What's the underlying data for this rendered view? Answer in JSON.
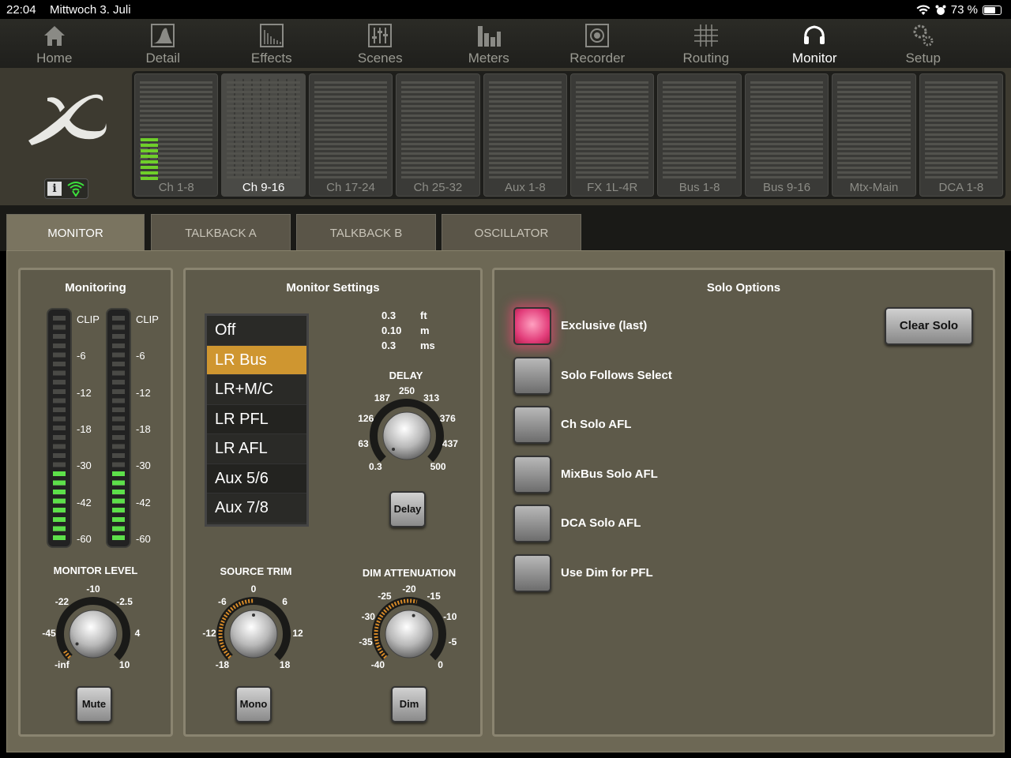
{
  "status": {
    "time": "22:04",
    "date": "Mittwoch 3. Juli",
    "battery": "73 %",
    "battery_level": 0.73
  },
  "nav": [
    {
      "label": "Home",
      "icon": "home-icon"
    },
    {
      "label": "Detail",
      "icon": "detail-icon"
    },
    {
      "label": "Effects",
      "icon": "effects-icon"
    },
    {
      "label": "Scenes",
      "icon": "scenes-icon"
    },
    {
      "label": "Meters",
      "icon": "meters-icon"
    },
    {
      "label": "Recorder",
      "icon": "recorder-icon"
    },
    {
      "label": "Routing",
      "icon": "routing-icon"
    },
    {
      "label": "Monitor",
      "icon": "monitor-icon",
      "active": true
    },
    {
      "label": "Setup",
      "icon": "setup-icon"
    }
  ],
  "banks": [
    "Ch 1-8",
    "Ch 9-16",
    "Ch 17-24",
    "Ch 25-32",
    "Aux 1-8",
    "FX 1L-4R",
    "Bus 1-8",
    "Bus 9-16",
    "Mtx-Main",
    "DCA 1-8"
  ],
  "selected_bank": "Ch 9-16",
  "tabs": [
    "MONITOR",
    "TALKBACK A",
    "TALKBACK B",
    "OSCILLATOR"
  ],
  "active_tab": "MONITOR",
  "monitoring": {
    "title": "Monitoring",
    "meter_labels": [
      "CLIP",
      "-6",
      "-12",
      "-18",
      "-30",
      "-42",
      "-60"
    ],
    "meter_level_segments": 8,
    "level_caption": "MONITOR LEVEL",
    "level_ticks": [
      "-10",
      "-22",
      "-2.5",
      "-45",
      "4",
      "-inf",
      "10"
    ],
    "mute_label": "Mute"
  },
  "settings": {
    "title": "Monitor Settings",
    "sources": [
      "Off",
      "LR Bus",
      "LR+M/C",
      "LR PFL",
      "LR AFL",
      "Aux 5/6",
      "Aux 7/8"
    ],
    "selected_source": "LR Bus",
    "delay_values": [
      {
        "value": "0.3",
        "unit": "ft"
      },
      {
        "value": "0.10",
        "unit": "m"
      },
      {
        "value": "0.3",
        "unit": "ms"
      }
    ],
    "delay_caption": "DELAY",
    "delay_ticks": [
      "250",
      "187",
      "313",
      "126",
      "376",
      "63",
      "437",
      "0.3",
      "500"
    ],
    "delay_button": "Delay",
    "trim_caption": "SOURCE TRIM",
    "trim_ticks": [
      "0",
      "-6",
      "6",
      "-12",
      "12",
      "-18",
      "18"
    ],
    "mono_button": "Mono",
    "dim_caption": "DIM ATTENUATION",
    "dim_ticks": [
      "-20",
      "-25",
      "-15",
      "-30",
      "-10",
      "-35",
      "-5",
      "-40",
      "0"
    ],
    "dim_button": "Dim"
  },
  "solo": {
    "title": "Solo Options",
    "options": [
      {
        "label": "Exclusive (last)",
        "on": true
      },
      {
        "label": "Solo Follows Select",
        "on": false
      },
      {
        "label": "Ch Solo AFL",
        "on": false
      },
      {
        "label": "MixBus Solo AFL",
        "on": false
      },
      {
        "label": "DCA Solo AFL",
        "on": false
      },
      {
        "label": "Use Dim for PFL",
        "on": false
      }
    ],
    "clear_button": "Clear Solo"
  }
}
